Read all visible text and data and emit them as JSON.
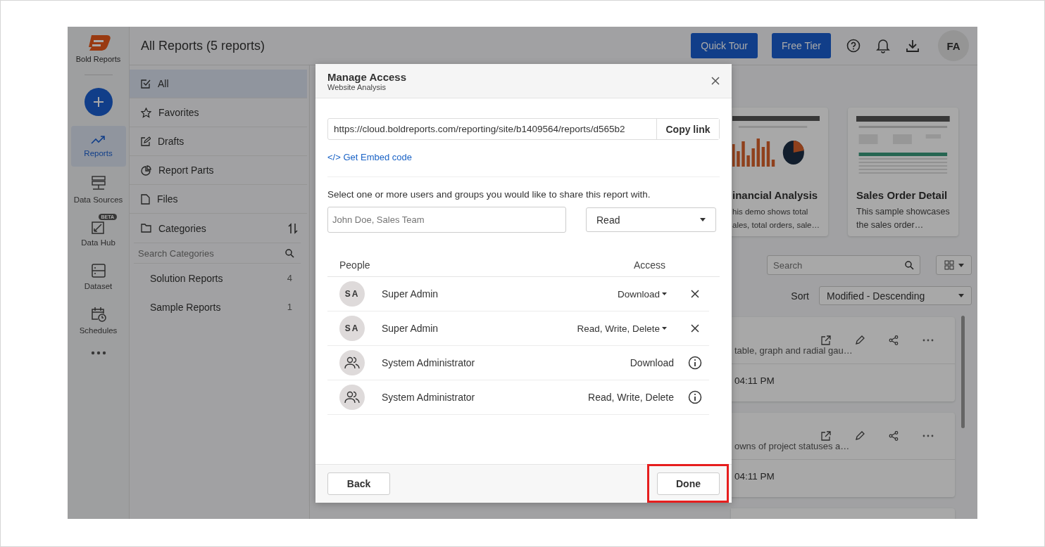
{
  "rail": {
    "logo": "Bold Reports",
    "items": [
      {
        "label": "Reports",
        "selected": true
      },
      {
        "label": "Data Sources",
        "selected": false
      },
      {
        "label": "Data Hub",
        "selected": false,
        "badge": "BETA"
      },
      {
        "label": "Dataset",
        "selected": false
      },
      {
        "label": "Schedules",
        "selected": false
      }
    ]
  },
  "topbar": {
    "title": "All Reports (5 reports)",
    "buttons": [
      "Quick Tour",
      "Free Tier"
    ],
    "avatar": "FA"
  },
  "sidebar": {
    "items": [
      {
        "label": "All",
        "selected": true
      },
      {
        "label": "Favorites",
        "selected": false
      },
      {
        "label": "Drafts",
        "selected": false
      },
      {
        "label": "Report Parts",
        "selected": false
      },
      {
        "label": "Files",
        "selected": false
      }
    ],
    "categories_label": "Categories",
    "search_placeholder": "Search Categories",
    "categories": [
      {
        "name": "Solution Reports",
        "count": "4"
      },
      {
        "name": "Sample Reports",
        "count": "1"
      }
    ]
  },
  "cards": [
    {
      "title": "inancial Analysis",
      "lines": [
        "his demo shows total",
        "ales, total orders, sale…"
      ]
    },
    {
      "title": "Sales Order Detail",
      "lines": [
        "This sample showcases",
        "the sales order…"
      ]
    }
  ],
  "search": {
    "placeholder": "Search"
  },
  "sort": {
    "label": "Sort",
    "value": "Modified - Descending"
  },
  "reports": [
    {
      "description": "table, graph and radial gau…",
      "time": "04:11 PM"
    },
    {
      "description": "owns of project statuses a…",
      "time": "04:11 PM"
    }
  ],
  "modal": {
    "title": "Manage Access",
    "subtitle": "Website Analysis",
    "url": "https://cloud.boldreports.com/reporting/site/b1409564/reports/d565b2",
    "copy": "Copy link",
    "embed": "</> Get Embed code",
    "instruction": "Select one or more users and groups you would like to share this report with.",
    "people_placeholder": "John Doe, Sales Team",
    "access_value": "Read",
    "columns": [
      "People",
      "Access"
    ],
    "entries": [
      {
        "kind": "user",
        "initials": "SA",
        "name": "Super Admin",
        "access": "Download"
      },
      {
        "kind": "user",
        "initials": "SA",
        "name": "Super Admin",
        "access": "Read, Write, Delete"
      },
      {
        "kind": "group",
        "name": "System Administrator",
        "access": "Download"
      },
      {
        "kind": "group",
        "name": "System Administrator",
        "access": "Read, Write, Delete"
      }
    ],
    "back": "Back",
    "done": "Done",
    "done_highlighted": true
  }
}
